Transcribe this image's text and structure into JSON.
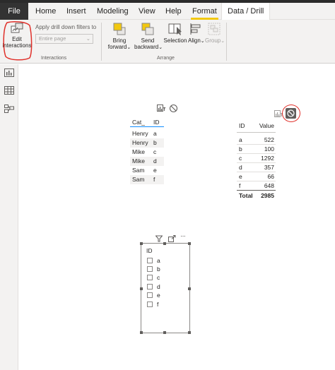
{
  "menu": {
    "file": "File",
    "home": "Home",
    "insert": "Insert",
    "modeling": "Modeling",
    "view": "View",
    "help": "Help",
    "format": "Format",
    "data_drill": "Data / Drill"
  },
  "ribbon": {
    "edit_interactions_line1": "Edit",
    "edit_interactions_line2": "interactions",
    "apply_drill_label": "Apply drill down filters to",
    "apply_drill_placeholder": "Entire page",
    "interactions_group": "Interactions",
    "bring_forward_line1": "Bring",
    "bring_forward_line2": "forward",
    "send_backward_line1": "Send",
    "send_backward_line2": "backward",
    "selection": "Selection",
    "align": "Align",
    "group": "Group",
    "arrange_group": "Arrange",
    "accent_color": "#f2c811",
    "annotation_color": "#e0302a"
  },
  "table1": {
    "headers": [
      "Cat_",
      "ID"
    ],
    "rows": [
      [
        "Henry",
        "a"
      ],
      [
        "Henry",
        "b"
      ],
      [
        "Mike",
        "c"
      ],
      [
        "Mike",
        "d"
      ],
      [
        "Sam",
        "e"
      ],
      [
        "Sam",
        "f"
      ]
    ]
  },
  "table2": {
    "headers": [
      "ID",
      "Value"
    ],
    "rows": [
      [
        "a",
        "522"
      ],
      [
        "b",
        "100"
      ],
      [
        "c",
        "1292"
      ],
      [
        "d",
        "357"
      ],
      [
        "e",
        "66"
      ],
      [
        "f",
        "648"
      ]
    ],
    "total_label": "Total",
    "total_value": "2985"
  },
  "slicer": {
    "header": "ID",
    "items": [
      "a",
      "b",
      "c",
      "d",
      "e",
      "f"
    ],
    "more_label": "···"
  }
}
